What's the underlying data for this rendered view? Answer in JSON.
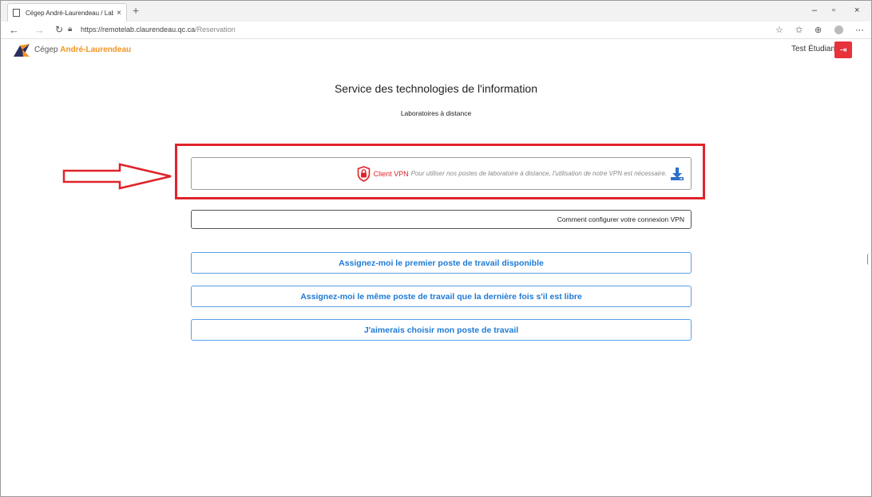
{
  "browser": {
    "tab_title": "Cégep André-Laurendeau / Labo",
    "tab_close": "×",
    "new_tab": "+",
    "window_controls": [
      "–",
      "▫",
      "×"
    ],
    "url_host": "https://remotelab.claurendeau.qc.ca",
    "url_path": "/Reservation",
    "nav": {
      "back": "←",
      "forward": "→",
      "refresh": "↻"
    },
    "toolbar_icons": [
      "☆",
      "✩",
      "⊕",
      "⋯"
    ]
  },
  "header": {
    "brand_prefix": "Cégep ",
    "brand_name": "André-Laurendeau",
    "user_name": "Test Étudiant",
    "logout_icon": "⇥"
  },
  "main": {
    "title": "Service des technologies de l'information",
    "subtitle": "Laboratoires à distance",
    "vpn": {
      "label": "Client VPN",
      "description": "Pour utiliser nos postes de laboratoire à distance, l'utilisation de notre VPN est nécessaire."
    },
    "config_link": "Comment configurer votre connexion VPN",
    "buttons": [
      "Assignez-moi le premier poste de travail disponible",
      "Assignez-moi le même poste de travail que la dernière fois s'il est libre",
      "J'aimerais choisir mon poste de travail"
    ]
  },
  "colors": {
    "accent_orange": "#f39423",
    "highlight_red": "#e0232b",
    "button_blue": "#1e7ad6"
  }
}
